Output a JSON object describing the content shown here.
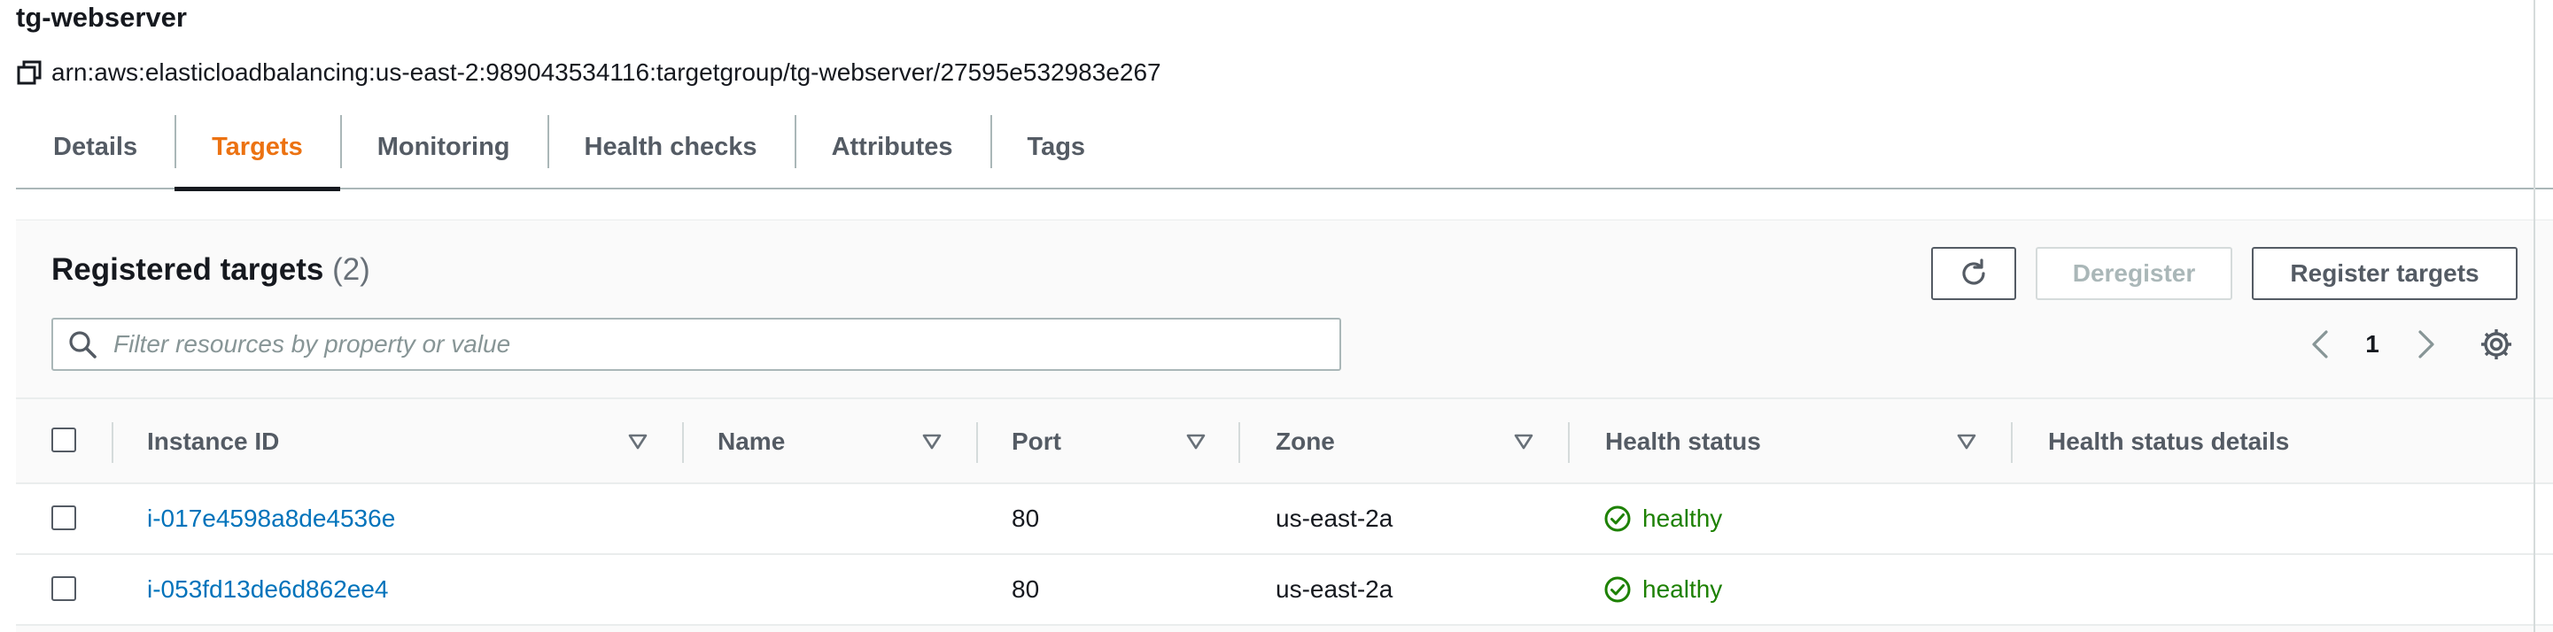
{
  "target_group": {
    "name": "tg-webserver",
    "arn": "arn:aws:elasticloadbalancing:us-east-2:989043534116:targetgroup/tg-webserver/27595e532983e267"
  },
  "tabs": [
    {
      "label": "Details",
      "active": false
    },
    {
      "label": "Targets",
      "active": true
    },
    {
      "label": "Monitoring",
      "active": false
    },
    {
      "label": "Health checks",
      "active": false
    },
    {
      "label": "Attributes",
      "active": false
    },
    {
      "label": "Tags",
      "active": false
    }
  ],
  "registered_targets": {
    "title": "Registered targets",
    "count": "(2)",
    "buttons": {
      "deregister": "Deregister",
      "register": "Register targets"
    },
    "search": {
      "placeholder": "Filter resources by property or value",
      "value": ""
    },
    "pagination": {
      "page": "1"
    },
    "columns": [
      "Instance ID",
      "Name",
      "Port",
      "Zone",
      "Health status",
      "Health status details"
    ],
    "rows": [
      {
        "instance_id": "i-017e4598a8de4536e",
        "name": "",
        "port": "80",
        "zone": "us-east-2a",
        "health_status": "healthy",
        "health_status_details": ""
      },
      {
        "instance_id": "i-053fd13de6d862ee4",
        "name": "",
        "port": "80",
        "zone": "us-east-2a",
        "health_status": "healthy",
        "health_status_details": ""
      }
    ]
  },
  "colors": {
    "accent_tab": "#ec7211",
    "link": "#0073bb",
    "healthy": "#1d8102"
  },
  "icons": [
    "copy-icon",
    "refresh-icon",
    "search-icon",
    "chevron-left-icon",
    "chevron-right-icon",
    "settings-gear-icon",
    "sort-caret-icon",
    "check-circle-icon"
  ]
}
